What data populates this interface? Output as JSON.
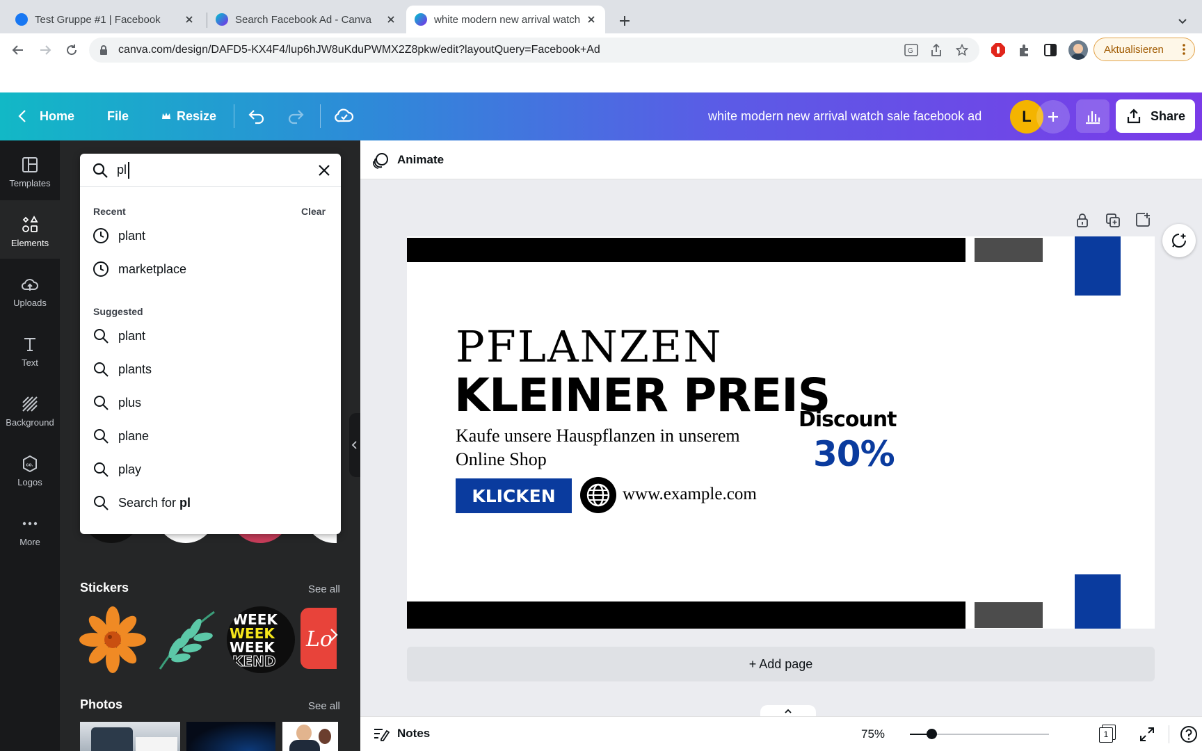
{
  "browser": {
    "tabs": [
      {
        "title": "Test Gruppe #1 | Facebook",
        "favicon": "facebook-icon"
      },
      {
        "title": "Search Facebook Ad - Canva",
        "favicon": "canva-icon"
      },
      {
        "title": "white modern new arrival watch sale facebook ad",
        "favicon": "canva-icon"
      }
    ],
    "url": "canva.com/design/DAFD5-KX4F4/lup6hJW8uKduPWMX2Z8pkw/edit?layoutQuery=Facebook+Ad",
    "update_button": "Aktualisieren"
  },
  "canva_bar": {
    "home": "Home",
    "file": "File",
    "resize": "Resize",
    "design_title": "white modern new arrival watch sale facebook ad",
    "avatar_letter": "L",
    "share": "Share"
  },
  "rail": [
    {
      "label": "Templates",
      "icon": "templates-icon"
    },
    {
      "label": "Elements",
      "icon": "elements-icon"
    },
    {
      "label": "Uploads",
      "icon": "uploads-icon"
    },
    {
      "label": "Text",
      "icon": "text-icon"
    },
    {
      "label": "Background",
      "icon": "background-icon"
    },
    {
      "label": "Logos",
      "icon": "logos-icon"
    },
    {
      "label": "More",
      "icon": "more-icon"
    }
  ],
  "search": {
    "value": "pl",
    "recent_label": "Recent",
    "clear_label": "Clear",
    "recent": [
      "plant",
      "marketplace"
    ],
    "suggested_label": "Suggested",
    "suggested": [
      "plant",
      "plants",
      "plus",
      "plane",
      "play"
    ],
    "search_for_prefix": "Search for ",
    "search_for_term": "pl"
  },
  "panel": {
    "stickers_title": "Stickers",
    "photos_title": "Photos",
    "see_all": "See all"
  },
  "editor": {
    "animate": "Animate",
    "add_page": "+ Add page",
    "notes": "Notes",
    "zoom": "75%",
    "page_number": "1"
  },
  "design": {
    "headline": "PFLANZEN",
    "subheadline": "KLEINER PREIS",
    "body_line1": "Kaufe unsere Hauspflanzen in unserem",
    "body_line2": "Online Shop",
    "button": "KLICKEN",
    "website": "www.example.com",
    "discount_label": "Discount",
    "discount_value": "30%",
    "accent_color": "#0a3b9e"
  }
}
